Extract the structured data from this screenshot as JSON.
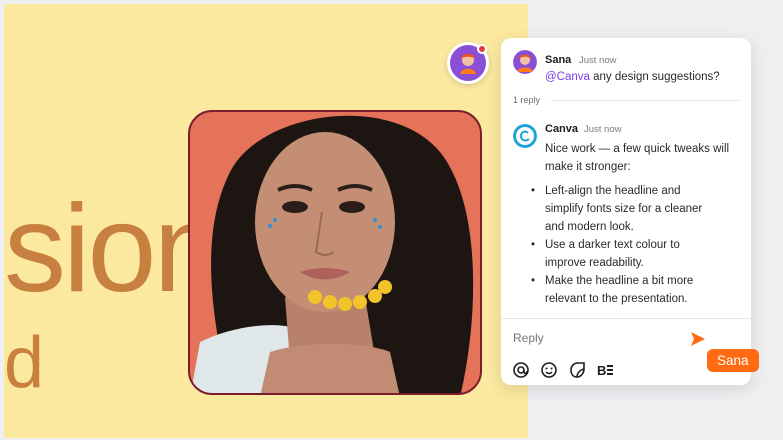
{
  "canvas": {
    "big_word": "sion",
    "small_word": "d"
  },
  "comments": {
    "first": {
      "author": "Sana",
      "time": "Just now",
      "mention": "@Canva",
      "text": " any design suggestions?"
    },
    "reply_count": "1 reply",
    "second": {
      "author": "Canva",
      "time": "Just now",
      "intro": "Nice work — a few quick tweaks will make it stronger:",
      "bullets": [
        "Left-align the headline and simplify fonts size for a cleaner and modern look.",
        "Use a darker text colour to improve readability.",
        "Make the headline a bit more relevant to the presentation."
      ]
    },
    "reply_placeholder": "Reply"
  },
  "cursor_label": "Sana",
  "icons": {
    "tools": [
      "at-icon",
      "emoji-icon",
      "sticker-icon",
      "text-format-icon"
    ],
    "send": "send-icon"
  },
  "colors": {
    "canvas_bg": "#fbe9a0",
    "headline": "#c7803f",
    "accent": "#ff6a13",
    "mention": "#7b3fe4"
  }
}
